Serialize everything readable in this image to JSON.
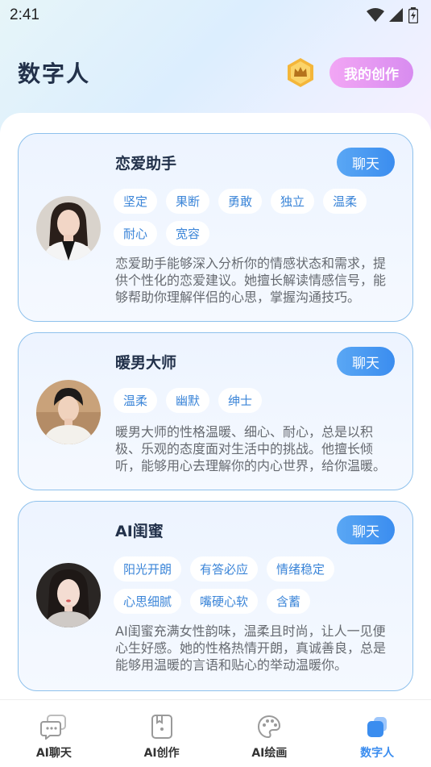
{
  "status_bar": {
    "time": "2:41"
  },
  "header": {
    "title": "数字人",
    "my_creation_label": "我的创作"
  },
  "characters": [
    {
      "name": "恋爱助手",
      "chat_label": "聊天",
      "tags": [
        "坚定",
        "果断",
        "勇敢",
        "独立",
        "温柔",
        "耐心",
        "宽容"
      ],
      "description": "恋爱助手能够深入分析你的情感状态和需求，提供个性化的恋爱建议。她擅长解读情感信号，能够帮助你理解伴侣的心思，掌握沟通技巧。"
    },
    {
      "name": "暖男大师",
      "chat_label": "聊天",
      "tags": [
        "温柔",
        "幽默",
        "绅士"
      ],
      "description": "暖男大师的性格温暖、细心、耐心，总是以积极、乐观的态度面对生活中的挑战。他擅长倾听，能够用心去理解你的内心世界，给你温暖。"
    },
    {
      "name": "AI闺蜜",
      "chat_label": "聊天",
      "tags": [
        "阳光开朗",
        "有答必应",
        "情绪稳定",
        "心思细腻",
        "嘴硬心软",
        "含蓄"
      ],
      "description": "AI闺蜜充满女性韵味，温柔且时尚，让人一见便心生好感。她的性格热情开朗，真诚善良，总是能够用温暖的言语和贴心的举动温暖你。"
    }
  ],
  "tabbar": [
    {
      "label": "AI聊天",
      "icon": "chat-bubble-icon"
    },
    {
      "label": "AI创作",
      "icon": "creation-icon"
    },
    {
      "label": "AI绘画",
      "icon": "palette-icon"
    },
    {
      "label": "数字人",
      "icon": "digital-human-icon",
      "active": true
    }
  ],
  "colors": {
    "accent": "#3b8def",
    "title": "#22314a",
    "tag_text": "#3b85d8",
    "card_border": "#8ec1ec"
  }
}
